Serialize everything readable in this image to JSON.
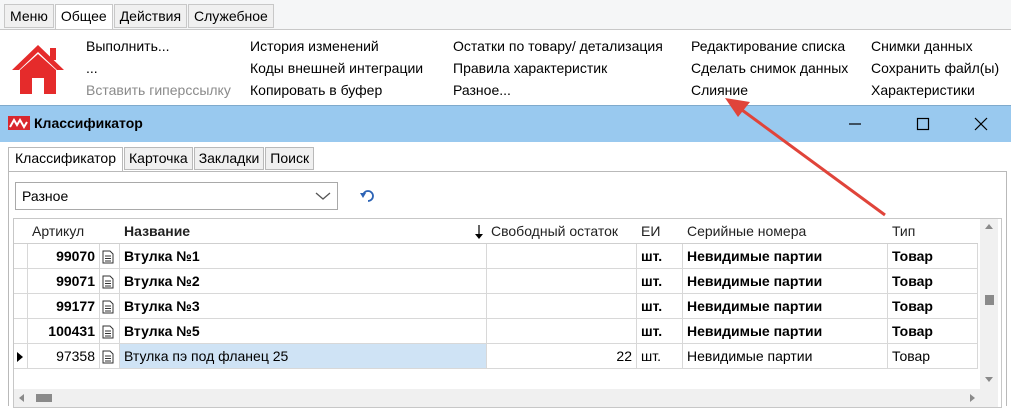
{
  "ribbon": {
    "tabs": [
      "Меню",
      "Общее",
      "Действия",
      "Служебное"
    ],
    "active_tab": "Общее",
    "col1": [
      "Выполнить...",
      "...",
      "Вставить гиперссылку"
    ],
    "col2": [
      "История изменений",
      "Коды внешней интеграции",
      "Копировать в буфер"
    ],
    "col3": [
      "Остатки по товару/ детализация",
      "Правила характеристик",
      "Разное..."
    ],
    "col4": [
      "Редактирование списка",
      "Сделать снимок данных",
      "Слияние"
    ],
    "col5": [
      "Снимки данных",
      "Сохранить файл(ы)",
      "Характеристики"
    ]
  },
  "window": {
    "title": "Классификатор",
    "tabs": [
      "Классификатор",
      "Карточка",
      "Закладки",
      "Поиск"
    ],
    "combo_value": "Разное"
  },
  "grid": {
    "headers": [
      "Артикул",
      "Название",
      "Свободный остаток",
      "ЕИ",
      "Серийные номера",
      "Тип"
    ],
    "rows": [
      {
        "article": "99070",
        "name": "Втулка №1",
        "stock": "",
        "unit": "шт.",
        "serial": "Невидимые партии",
        "type": "Товар"
      },
      {
        "article": "99071",
        "name": "Втулка №2",
        "stock": "",
        "unit": "шт.",
        "serial": "Невидимые партии",
        "type": "Товар"
      },
      {
        "article": "99177",
        "name": "Втулка №3",
        "stock": "",
        "unit": "шт.",
        "serial": "Невидимые партии",
        "type": "Товар"
      },
      {
        "article": "100431",
        "name": "Втулка №5",
        "stock": "",
        "unit": "шт.",
        "serial": "Невидимые партии",
        "type": "Товар"
      },
      {
        "article": "97358",
        "name": "Втулка пэ под фланец 25",
        "stock": "22",
        "unit": "шт.",
        "serial": "Невидимые партии",
        "type": "Товар"
      }
    ]
  },
  "colors": {
    "title_bar": "#99c9ef",
    "selected_cell": "#cfe3f5",
    "arrow": "#e0443a",
    "home_icon": "#e52b2b"
  }
}
